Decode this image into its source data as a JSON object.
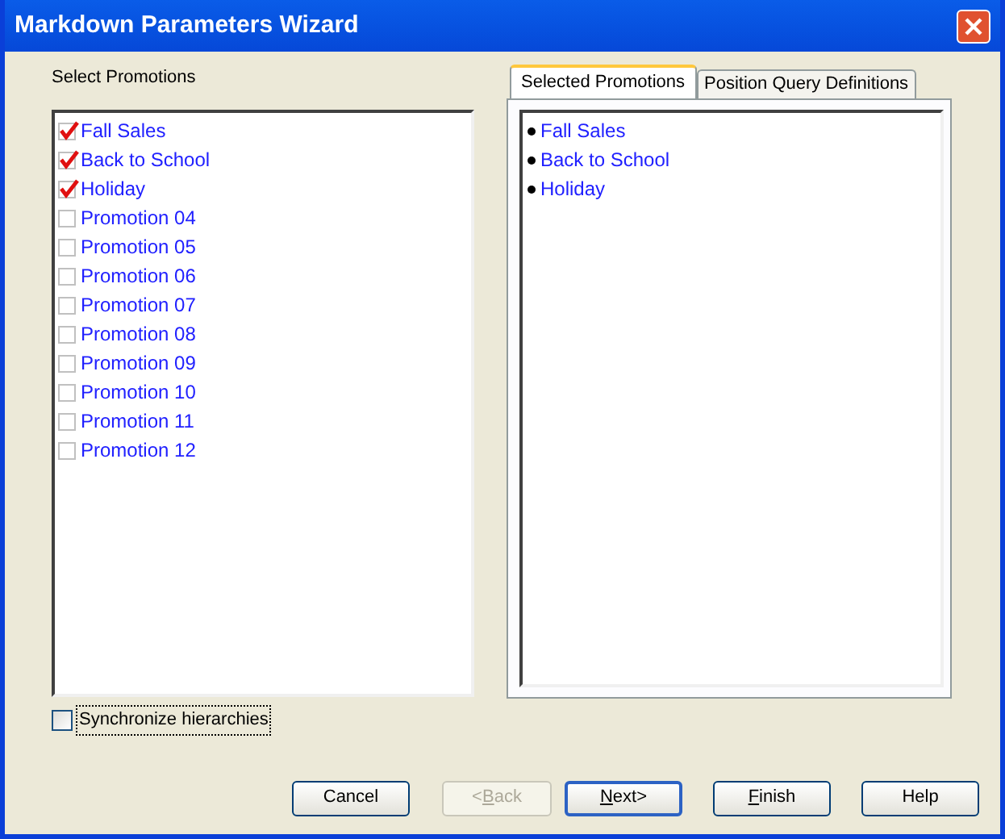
{
  "window": {
    "title": "Markdown Parameters Wizard"
  },
  "promotions": {
    "label": "Select Promotions",
    "items": [
      {
        "label": "Fall Sales",
        "checked": true
      },
      {
        "label": "Back to School",
        "checked": true
      },
      {
        "label": "Holiday",
        "checked": true
      },
      {
        "label": "Promotion 04",
        "checked": false
      },
      {
        "label": "Promotion 05",
        "checked": false
      },
      {
        "label": "Promotion 06",
        "checked": false
      },
      {
        "label": "Promotion 07",
        "checked": false
      },
      {
        "label": "Promotion 08",
        "checked": false
      },
      {
        "label": "Promotion 09",
        "checked": false
      },
      {
        "label": "Promotion 10",
        "checked": false
      },
      {
        "label": "Promotion 11",
        "checked": false
      },
      {
        "label": "Promotion 12",
        "checked": false
      }
    ]
  },
  "tabs": [
    {
      "label": "Selected Promotions",
      "selected": true
    },
    {
      "label": "Position Query Definitions",
      "selected": false
    }
  ],
  "selected_promotions": [
    "Fall Sales",
    "Back to School",
    "Holiday"
  ],
  "synchronize": {
    "label": "Synchronize hierarchies",
    "checked": false
  },
  "buttons": [
    {
      "label": "Cancel",
      "disabled": false,
      "default": false
    },
    {
      "label_before": "<",
      "access_key": "B",
      "label_after": "ack",
      "disabled": true,
      "default": false
    },
    {
      "access_key": "N",
      "label_after": "ext>",
      "disabled": false,
      "default": true
    },
    {
      "access_key": "F",
      "label_after": "inish",
      "disabled": false,
      "default": false
    },
    {
      "label": "Help",
      "disabled": false,
      "default": false
    }
  ]
}
